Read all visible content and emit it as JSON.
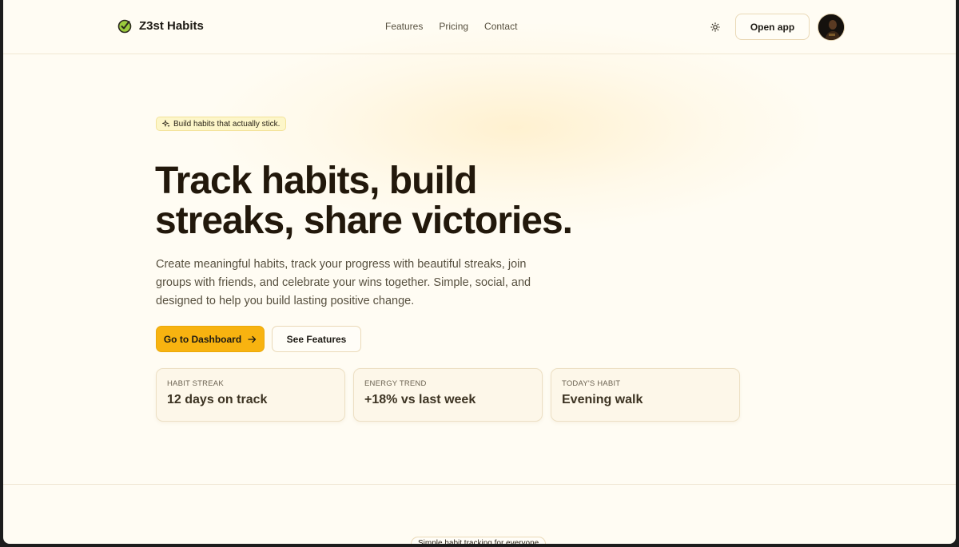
{
  "header": {
    "brand_name": "Z3st Habits",
    "nav": [
      {
        "label": "Features"
      },
      {
        "label": "Pricing"
      },
      {
        "label": "Contact"
      }
    ],
    "open_app_label": "Open app"
  },
  "hero": {
    "badge_text": "Build habits that actually stick.",
    "headline_line1": "Track habits, build",
    "headline_line2": "streaks, share victories.",
    "subtext": "Create meaningful habits, track your progress with beautiful streaks, join groups with friends, and celebrate your wins together. Simple, social, and designed to help you build lasting positive change.",
    "primary_cta": "Go to Dashboard",
    "secondary_cta": "See Features"
  },
  "cards": [
    {
      "label": "HABIT STREAK",
      "value": "12 days on track"
    },
    {
      "label": "ENERGY TREND",
      "value": "+18% vs last week"
    },
    {
      "label": "TODAY'S HABIT",
      "value": "Evening walk"
    }
  ],
  "footer_pill": "Simple habit tracking for everyone",
  "colors": {
    "background": "#fffcf3",
    "accent": "#f8b310",
    "text": "#22180b",
    "brand_icon": "#7cb82f"
  },
  "icons": {
    "brand": "check-circle-icon",
    "theme": "sun-icon",
    "badge": "sparkles-icon",
    "cta": "arrow-right-icon"
  }
}
